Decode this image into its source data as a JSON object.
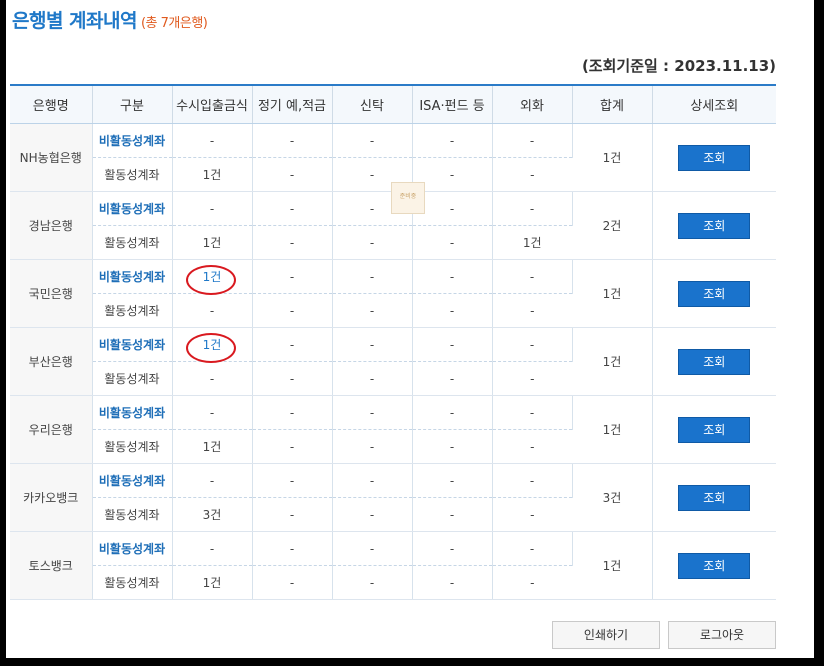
{
  "title": {
    "main": "은행별 계좌내역",
    "sub": "(총 7개은행)"
  },
  "base_date": "(조회기준일 : 2023.11.13)",
  "columns": [
    "은행명",
    "구분",
    "수시입출금식",
    "정기 예,적금",
    "신탁",
    "ISA·펀드 등",
    "외화",
    "합계",
    "상세조회"
  ],
  "view_button": "조회",
  "placeholder_text": "준비중",
  "banks": [
    {
      "name": "NH농협은행",
      "inactive_label": "비활동성계좌",
      "active_label": "활동성계좌",
      "inactive": [
        "-",
        "-",
        "-",
        "-",
        "-"
      ],
      "active": [
        "1건",
        "-",
        "-",
        "-",
        "-"
      ],
      "total": "1건"
    },
    {
      "name": "경남은행",
      "inactive_label": "비활동성계좌",
      "active_label": "활동성계좌",
      "inactive": [
        "-",
        "-",
        "-",
        "-",
        "-"
      ],
      "active": [
        "1건",
        "-",
        "-",
        "-",
        "1건"
      ],
      "total": "2건"
    },
    {
      "name": "국민은행",
      "inactive_label": "비활동성계좌",
      "active_label": "활동성계좌",
      "inactive": [
        "1건",
        "-",
        "-",
        "-",
        "-"
      ],
      "active": [
        "-",
        "-",
        "-",
        "-",
        "-"
      ],
      "total": "1건"
    },
    {
      "name": "부산은행",
      "inactive_label": "비활동성계좌",
      "active_label": "활동성계좌",
      "inactive": [
        "1건",
        "-",
        "-",
        "-",
        "-"
      ],
      "active": [
        "-",
        "-",
        "-",
        "-",
        "-"
      ],
      "total": "1건"
    },
    {
      "name": "우리은행",
      "inactive_label": "비활동성계좌",
      "active_label": "활동성계좌",
      "inactive": [
        "-",
        "-",
        "-",
        "-",
        "-"
      ],
      "active": [
        "1건",
        "-",
        "-",
        "-",
        "-"
      ],
      "total": "1건"
    },
    {
      "name": "카카오뱅크",
      "inactive_label": "비활동성계좌",
      "active_label": "활동성계좌",
      "inactive": [
        "-",
        "-",
        "-",
        "-",
        "-"
      ],
      "active": [
        "3건",
        "-",
        "-",
        "-",
        "-"
      ],
      "total": "3건"
    },
    {
      "name": "토스뱅크",
      "inactive_label": "비활동성계좌",
      "active_label": "활동성계좌",
      "inactive": [
        "-",
        "-",
        "-",
        "-",
        "-"
      ],
      "active": [
        "1건",
        "-",
        "-",
        "-",
        "-"
      ],
      "total": "1건"
    }
  ],
  "footer": {
    "print": "인쇄하기",
    "logout": "로그아웃"
  },
  "colors": {
    "accent": "#1f78c8",
    "button": "#1a73cc",
    "highlight": "#d9191f",
    "subtitle": "#e05a1e"
  }
}
